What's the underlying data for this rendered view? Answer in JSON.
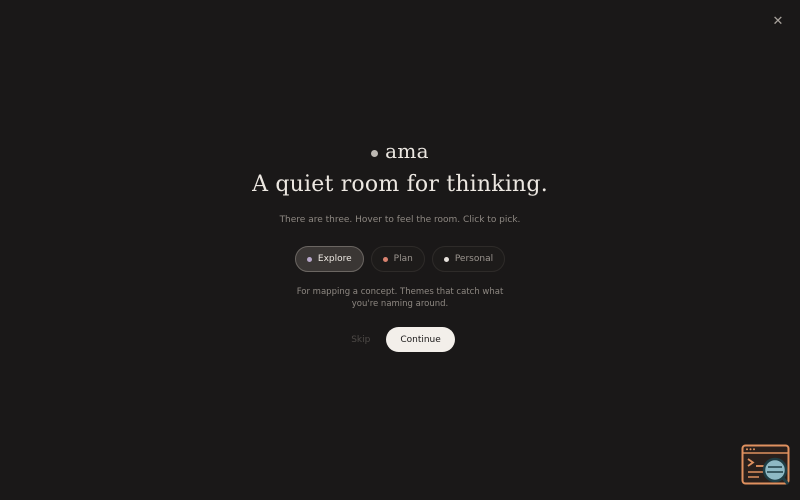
{
  "close": {
    "icon": "close-icon",
    "glyph": "✕"
  },
  "brand": {
    "name": "ama",
    "dot_color": "#bdb8b3"
  },
  "headline": "A quiet room for thinking.",
  "subtitle": "There are three. Hover to feel the room. Click to pick.",
  "modes": [
    {
      "label": "Explore",
      "dot_color": "#b7a7c9",
      "selected": true
    },
    {
      "label": "Plan",
      "dot_color": "#d9826f",
      "selected": false
    },
    {
      "label": "Personal",
      "dot_color": "#e6e1dc",
      "selected": false
    }
  ],
  "description": "For mapping a concept. Themes that catch what you're naming around.",
  "actions": {
    "skip_label": "Skip",
    "continue_label": "Continue"
  },
  "corner_widget": {
    "icon": "terminal-search-icon",
    "accent": "#e0915f"
  }
}
